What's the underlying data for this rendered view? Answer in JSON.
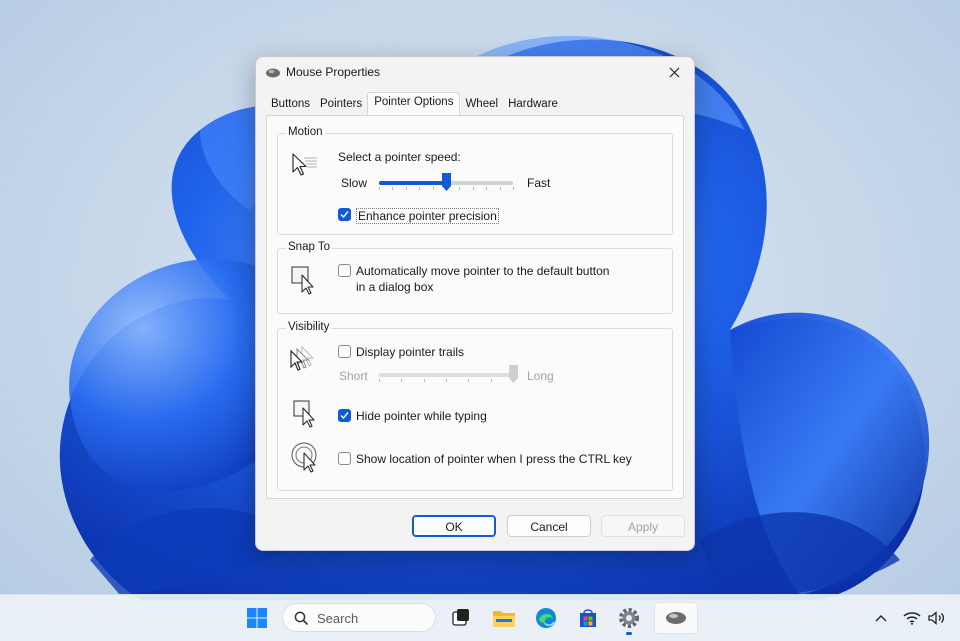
{
  "window": {
    "title": "Mouse Properties",
    "tabs": [
      "Buttons",
      "Pointers",
      "Pointer Options",
      "Wheel",
      "Hardware"
    ],
    "active_tab": "Pointer Options"
  },
  "motion": {
    "group_label": "Motion",
    "speed_label": "Select a pointer speed:",
    "slow_label": "Slow",
    "fast_label": "Fast",
    "speed_fraction": 0.5,
    "enhance_label": "Enhance pointer precision",
    "enhance_checked": true
  },
  "snap": {
    "group_label": "Snap To",
    "option_line1": "Automatically move pointer to the default button",
    "option_line2": "in a dialog box",
    "checked": false
  },
  "visibility": {
    "group_label": "Visibility",
    "trails_label": "Display pointer trails",
    "trails_checked": false,
    "short_label": "Short",
    "long_label": "Long",
    "trails_fraction": 1.0,
    "hide_label": "Hide pointer while typing",
    "hide_checked": true,
    "show_location_label": "Show location of pointer when I press the CTRL key",
    "show_location_checked": false
  },
  "buttons": {
    "ok": "OK",
    "cancel": "Cancel",
    "apply": "Apply"
  },
  "taskbar": {
    "search_placeholder": "Search",
    "icons": [
      "windows-start-icon",
      "search-icon",
      "task-view-icon",
      "file-explorer-icon",
      "edge-browser-icon",
      "microsoft-store-icon",
      "settings-gear-icon",
      "mouse-app-icon"
    ],
    "tray_icons": [
      "chevron-up-icon",
      "wifi-icon",
      "speaker-icon"
    ]
  },
  "colors": {
    "accent": "#0f5bd6",
    "wallpaper_blue": "#1a5fe0"
  }
}
